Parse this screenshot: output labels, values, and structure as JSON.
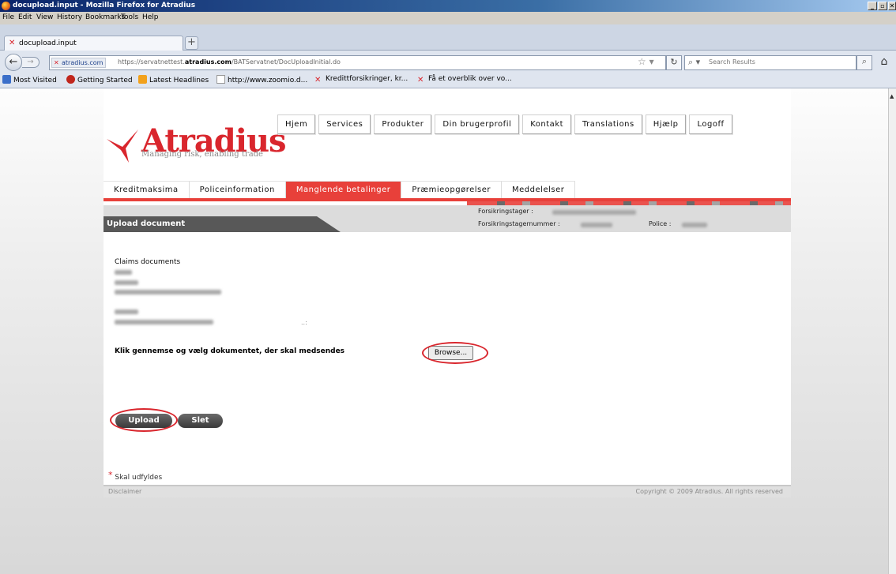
{
  "window": {
    "title": "docupload.input - Mozilla Firefox for Atradius"
  },
  "menu": {
    "items": [
      "File",
      "Edit",
      "View",
      "History",
      "Bookmarks",
      "Tools",
      "Help"
    ]
  },
  "tabs": [
    {
      "label": "docupload.input"
    }
  ],
  "navbar": {
    "site_label": "atradius.com",
    "url_prefix": "https://servatnettest.",
    "url_domain": "atradius.com",
    "url_suffix": "/BATServatnet/DocUploadInitial.do",
    "search_placeholder": "Search Results"
  },
  "bookmarks": [
    {
      "label": "Most Visited",
      "icon": "most-visited-icon"
    },
    {
      "label": "Getting Started",
      "icon": "firefox-icon"
    },
    {
      "label": "Latest Headlines",
      "icon": "rss-icon"
    },
    {
      "label": "http://www.zoomio.d...",
      "icon": "page-icon"
    },
    {
      "label": "Kredittforsikringer, kr...",
      "icon": "atradius-icon"
    },
    {
      "label": "Få et overblik over vo...",
      "icon": "atradius-icon"
    }
  ],
  "brand": {
    "name": "Atradius",
    "tagline": "Managing risk, enabling trade",
    "color": "#d9262d"
  },
  "topnav": [
    "Hjem",
    "Services",
    "Produkter",
    "Din brugerprofil",
    "Kontakt",
    "Translations",
    "Hjælp",
    "Logoff"
  ],
  "subtabs": {
    "items": [
      "Kreditmaksima",
      "Policeinformation",
      "Manglende betalinger",
      "Præmieopgørelser",
      "Meddelelser"
    ],
    "active": "Manglende betalinger"
  },
  "page": {
    "heading": "Upload document",
    "forsikringstager_label": "Forsikringstager :",
    "forsikringstagernummer_label": "Forsikringstagernummer :",
    "police_label": "Police :",
    "claims_title": "Claims documents",
    "resize_glyph": "..:",
    "browse_hint": "Klik gennemse og vælg dokumentet, der skal medsendes",
    "browse_label": "Browse...",
    "upload_label": "Upload",
    "slet_label": "Slet",
    "required_mark": "*",
    "required_text": "Skal udfyldes"
  },
  "footer": {
    "left": "Disclaimer",
    "right": "Copyright © 2009 Atradius. All rights reserved"
  },
  "colors": {
    "accent": "#e8403a",
    "annotation_ring": "#d9262d",
    "header_dark": "#585858"
  }
}
